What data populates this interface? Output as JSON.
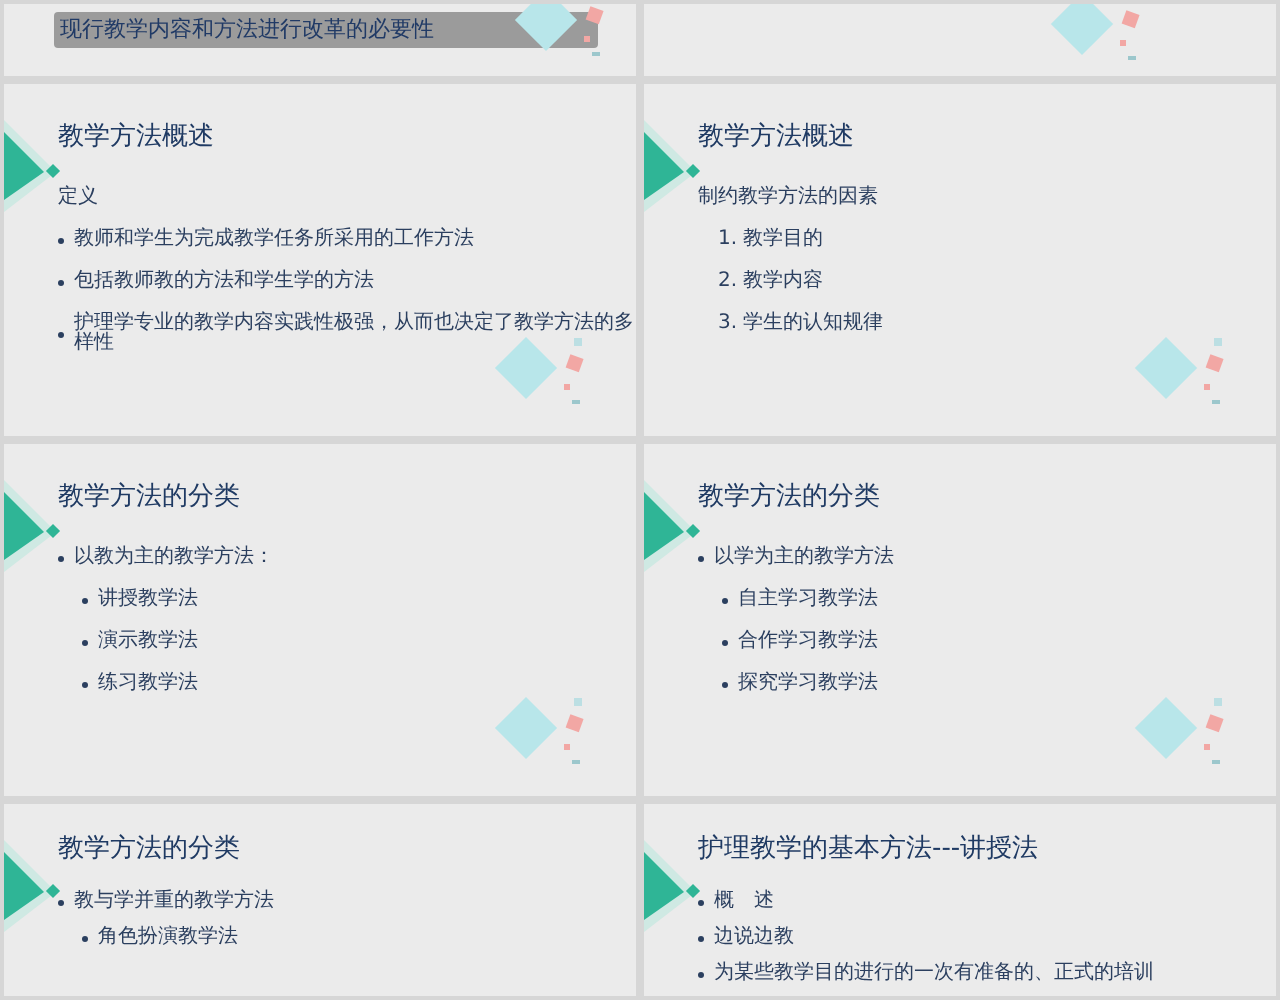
{
  "slides": [
    {
      "kind": "cut-top",
      "highlight": "现行教学内容和方法进行改革的必要性"
    },
    {
      "kind": "cut-top"
    },
    {
      "kind": "full",
      "title": "教学方法概述",
      "items": [
        {
          "kind": "label",
          "text": "定义"
        },
        {
          "kind": "bullet",
          "text": "教师和学生为完成教学任务所采用的工作方法"
        },
        {
          "kind": "bullet",
          "text": "包括教师教的方法和学生学的方法"
        },
        {
          "kind": "bullet",
          "text": "护理学专业的教学内容实践性极强，从而也决定了教学方法的多样性"
        }
      ]
    },
    {
      "kind": "full",
      "title": "教学方法概述",
      "items": [
        {
          "kind": "label",
          "text": "制约教学方法的因素"
        },
        {
          "kind": "sub",
          "text": "1. 教学目的"
        },
        {
          "kind": "sub",
          "text": "2. 教学内容"
        },
        {
          "kind": "sub",
          "text": "3. 学生的认知规律"
        }
      ]
    },
    {
      "kind": "full",
      "title": "教学方法的分类",
      "items": [
        {
          "kind": "bullet",
          "text": "以教为主的教学方法："
        },
        {
          "kind": "sub-bullet",
          "text": "讲授教学法"
        },
        {
          "kind": "sub-bullet",
          "text": "演示教学法"
        },
        {
          "kind": "sub-bullet",
          "text": "练习教学法"
        }
      ]
    },
    {
      "kind": "full",
      "title": "教学方法的分类",
      "items": [
        {
          "kind": "bullet",
          "text": "以学为主的教学方法"
        },
        {
          "kind": "sub-bullet",
          "text": "自主学习教学法"
        },
        {
          "kind": "sub-bullet",
          "text": "合作学习教学法"
        },
        {
          "kind": "sub-bullet",
          "text": "探究学习教学法"
        }
      ]
    },
    {
      "kind": "cut-bottom",
      "title": "教学方法的分类",
      "items": [
        {
          "kind": "bullet",
          "text": "教与学并重的教学方法"
        },
        {
          "kind": "sub-bullet",
          "text": "角色扮演教学法"
        }
      ]
    },
    {
      "kind": "cut-bottom",
      "title": "护理教学的基本方法---讲授法",
      "items": [
        {
          "kind": "bullet",
          "text": "概　述"
        },
        {
          "kind": "bullet",
          "text": "边说边教"
        },
        {
          "kind": "bullet",
          "text": "为某些教学目的进行的一次有准备的、正式的培训"
        }
      ]
    }
  ]
}
